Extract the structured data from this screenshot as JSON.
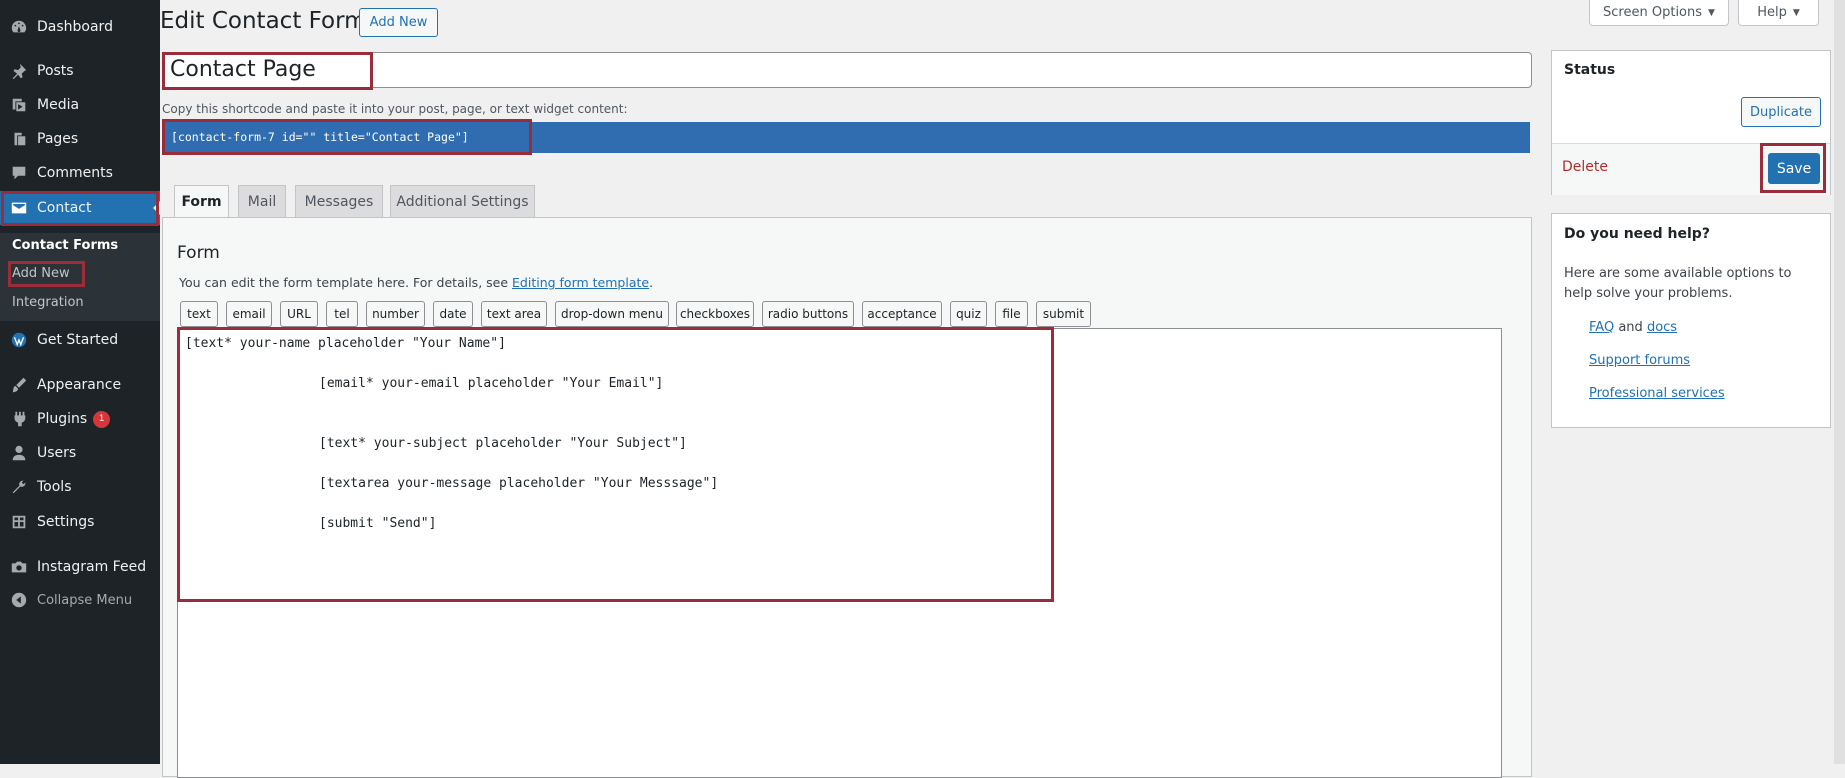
{
  "sidebar": {
    "items": [
      {
        "label": "Dashboard",
        "icon": "dashboard-icon"
      },
      {
        "label": "Posts",
        "icon": "pin-icon"
      },
      {
        "label": "Media",
        "icon": "media-icon"
      },
      {
        "label": "Pages",
        "icon": "pages-icon"
      },
      {
        "label": "Comments",
        "icon": "comments-icon"
      },
      {
        "label": "Contact",
        "icon": "mail-icon"
      },
      {
        "label": "Get Started",
        "icon": "wordpress-icon"
      },
      {
        "label": "Appearance",
        "icon": "brush-icon"
      },
      {
        "label": "Plugins",
        "icon": "plugin-icon",
        "badge": "1"
      },
      {
        "label": "Users",
        "icon": "user-icon"
      },
      {
        "label": "Tools",
        "icon": "wrench-icon"
      },
      {
        "label": "Settings",
        "icon": "settings-icon"
      },
      {
        "label": "Instagram Feed",
        "icon": "camera-icon"
      },
      {
        "label": "Collapse Menu",
        "icon": "collapse-icon"
      }
    ],
    "submenu": [
      "Contact Forms",
      "Add New",
      "Integration"
    ]
  },
  "header": {
    "title": "Edit Contact Form",
    "add_new": "Add New",
    "screen_options": "Screen Options",
    "help": "Help"
  },
  "form": {
    "title_value": "Contact Page",
    "shortcode_hint": "Copy this shortcode and paste it into your post, page, or text widget content:",
    "shortcode": "[contact-form-7 id=\"\" title=\"Contact Page\"]",
    "tabs": [
      "Form",
      "Mail",
      "Messages",
      "Additional Settings"
    ],
    "section_title": "Form",
    "description": "You can edit the form template here. For details, see ",
    "description_link": "Editing form template",
    "description_end": ".",
    "tag_buttons": [
      "text",
      "email",
      "URL",
      "tel",
      "number",
      "date",
      "text area",
      "drop-down menu",
      "checkboxes",
      "radio buttons",
      "acceptance",
      "quiz",
      "file",
      "submit"
    ],
    "template_lines": [
      "[text* your-name placeholder \"Your Name\"]",
      "[email* your-email placeholder \"Your Email\"]",
      "[text* your-subject placeholder \"Your Subject\"]",
      "[textarea your-message placeholder \"Your Messsage\"]",
      "[submit \"Send\"]"
    ]
  },
  "status_box": {
    "title": "Status",
    "duplicate": "Duplicate",
    "delete": "Delete",
    "save": "Save"
  },
  "help_box": {
    "title": "Do you need help?",
    "text": "Here are some available options to help solve your problems.",
    "faq": "FAQ",
    "and": "and",
    "docs": "docs",
    "support": "Support forums",
    "professional": "Professional services"
  },
  "colors": {
    "sidebar_bg": "#1d2327",
    "accent": "#2271b1",
    "highlight_border": "#9b2c3a",
    "delete": "#b32d2e"
  }
}
